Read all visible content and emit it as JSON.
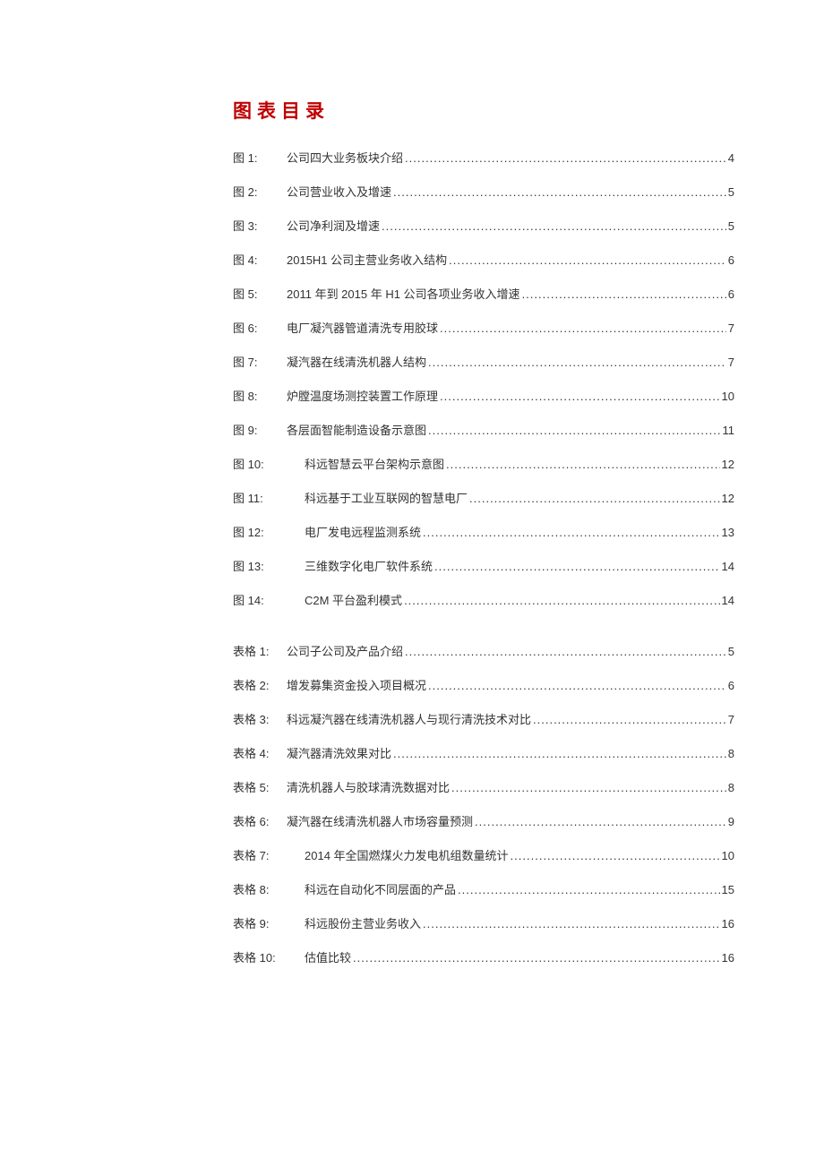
{
  "title": "图表目录",
  "figures": [
    {
      "label": "图 1:",
      "title": "公司四大业务板块介绍",
      "page": "4",
      "indent": false
    },
    {
      "label": "图 2:",
      "title": "公司营业收入及增速",
      "page": "5",
      "indent": false
    },
    {
      "label": "图 3:",
      "title": "公司净利润及增速",
      "page": "5",
      "indent": false
    },
    {
      "label": "图 4:",
      "title": "2015H1 公司主营业务收入结构",
      "page": "6",
      "indent": false
    },
    {
      "label": "图 5:",
      "title": "2011 年到 2015 年 H1 公司各项业务收入增速",
      "page": "6",
      "indent": false
    },
    {
      "label": "图 6:",
      "title": "电厂凝汽器管道清洗专用胶球",
      "page": "7",
      "indent": false
    },
    {
      "label": "图 7:",
      "title": "凝汽器在线清洗机器人结构",
      "page": "7",
      "indent": false
    },
    {
      "label": "图 8:",
      "title": "炉膛温度场测控装置工作原理",
      "page": "10",
      "indent": false
    },
    {
      "label": "图 9:",
      "title": "各层面智能制造设备示意图",
      "page": "11",
      "indent": false
    },
    {
      "label": "图 10:",
      "title": "科远智慧云平台架构示意图",
      "page": "12",
      "indent": true
    },
    {
      "label": "图 11:",
      "title": "科远基于工业互联网的智慧电厂",
      "page": "12",
      "indent": true
    },
    {
      "label": "图 12:",
      "title": "电厂发电远程监测系统",
      "page": "13",
      "indent": true
    },
    {
      "label": "图 13:",
      "title": "三维数字化电厂软件系统",
      "page": "14",
      "indent": true
    },
    {
      "label": "图 14:",
      "title": "C2M 平台盈利模式",
      "page": "14",
      "indent": true
    }
  ],
  "tables": [
    {
      "label": "表格 1:",
      "title": "公司子公司及产品介绍",
      "page": "5",
      "indent": false
    },
    {
      "label": "表格 2:",
      "title": "增发募集资金投入项目概况",
      "page": "6",
      "indent": false
    },
    {
      "label": "表格 3:",
      "title": "科远凝汽器在线清洗机器人与现行清洗技术对比",
      "page": "7",
      "indent": false
    },
    {
      "label": "表格 4:",
      "title": "凝汽器清洗效果对比",
      "page": "8",
      "indent": false
    },
    {
      "label": "表格 5:",
      "title": "清洗机器人与胶球清洗数据对比",
      "page": "8",
      "indent": false
    },
    {
      "label": "表格 6:",
      "title": "凝汽器在线清洗机器人市场容量预测",
      "page": "9",
      "indent": false
    },
    {
      "label": "表格 7:",
      "title": "2014 年全国燃煤火力发电机组数量统计",
      "page": "10",
      "indent": true
    },
    {
      "label": "表格 8:",
      "title": "科远在自动化不同层面的产品",
      "page": "15",
      "indent": true
    },
    {
      "label": "表格 9:",
      "title": "科远股份主营业务收入",
      "page": "16",
      "indent": true
    },
    {
      "label": "表格 10:",
      "title": "估值比较",
      "page": "16",
      "indent": true
    }
  ]
}
